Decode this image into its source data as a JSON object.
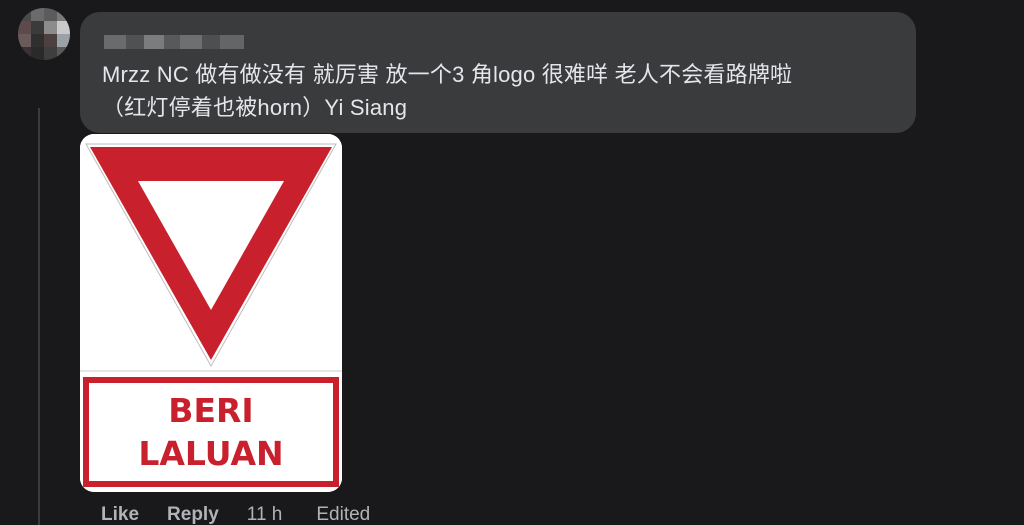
{
  "comment": {
    "text_line1": "Mrzz NC 做有做没有 就厉害 放一个3 角logo 很难咩 老人不会看路牌啦",
    "text_line2": "（红灯停着也被horn）Yi Siang"
  },
  "attachment": {
    "sign_line1": "BERI",
    "sign_line2": "LALUAN",
    "sign_red": "#c8202c"
  },
  "actions": {
    "like_label": "Like",
    "reply_label": "Reply",
    "time_label": "11 h",
    "edited_label": "Edited"
  }
}
